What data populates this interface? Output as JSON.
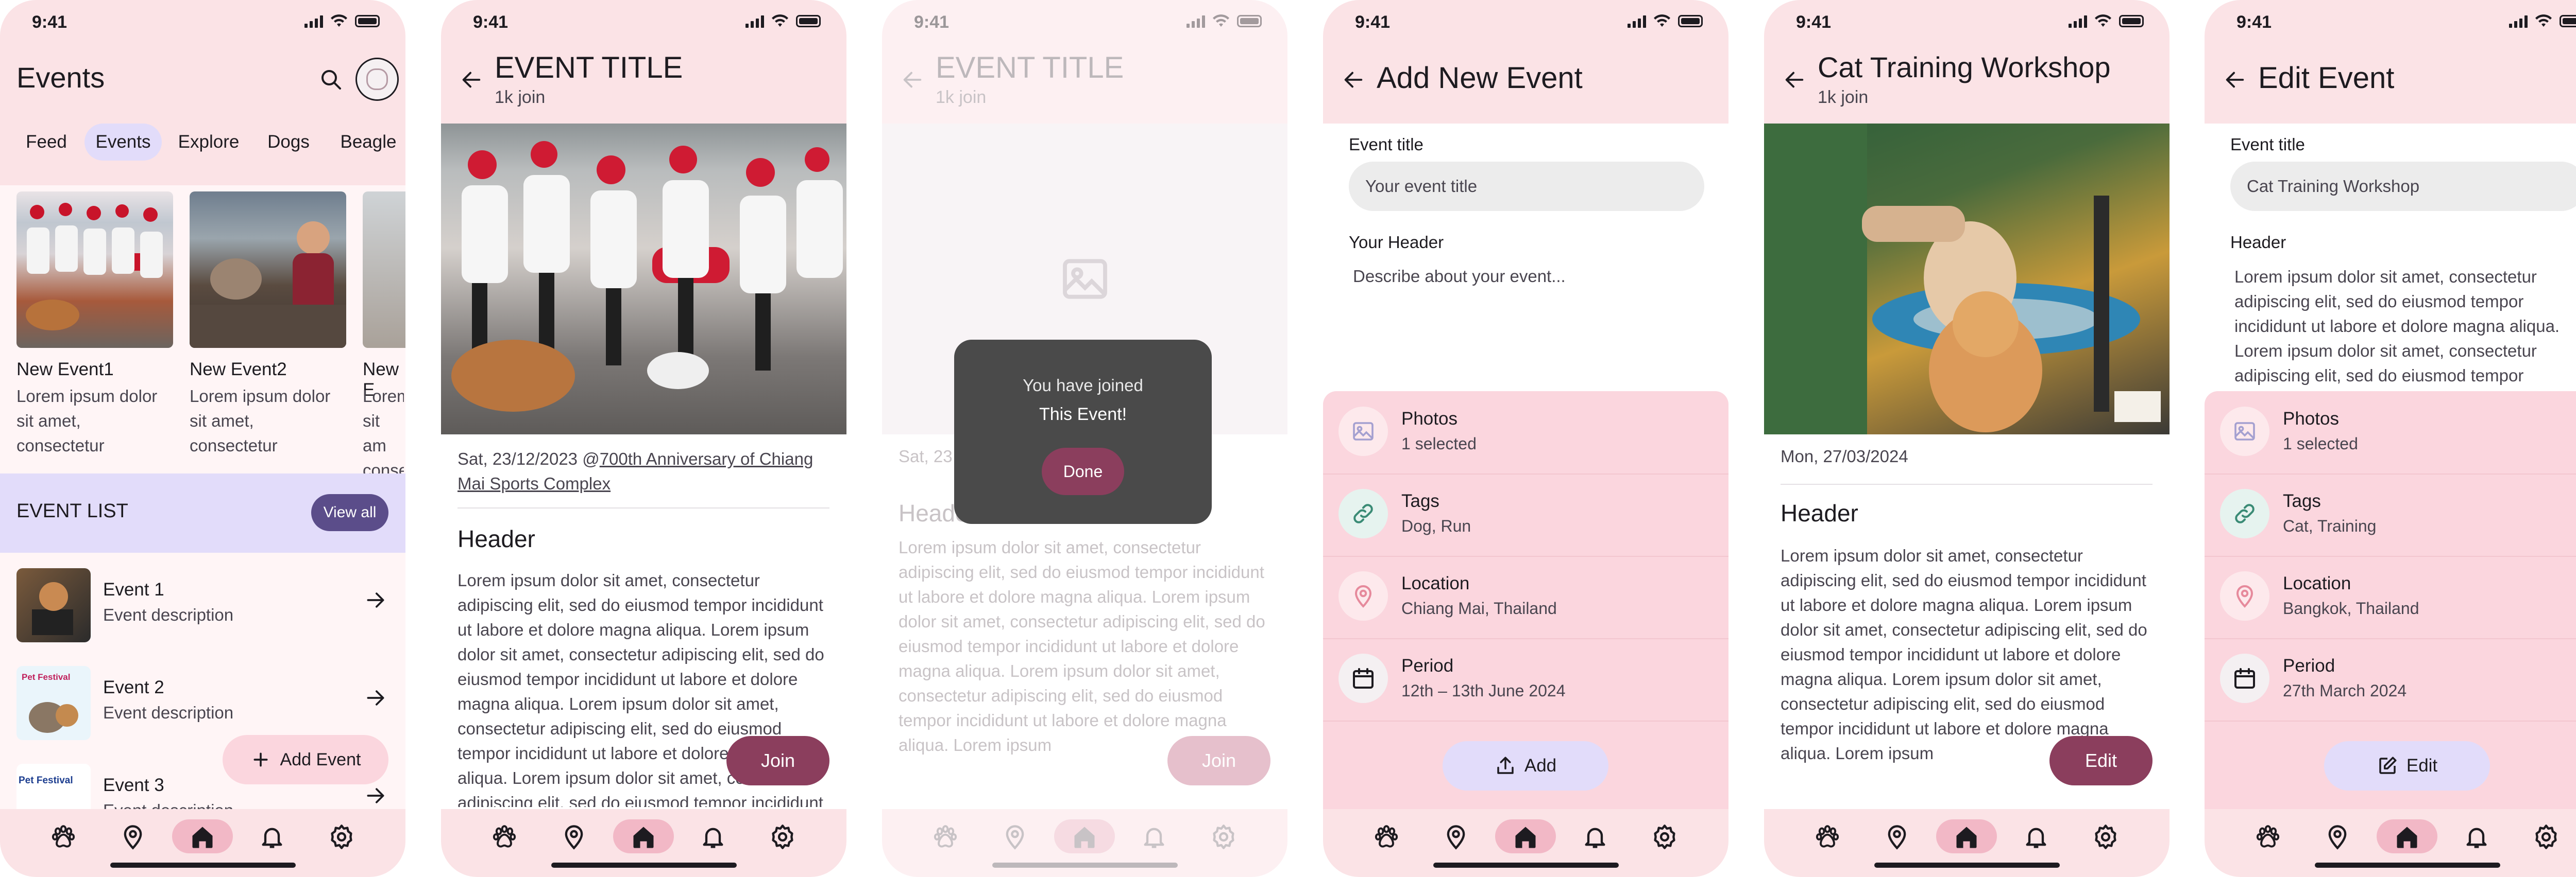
{
  "status": {
    "time": "9:41"
  },
  "colors": {
    "pink_bg": "#fbe3e6",
    "accent": "#8b3e5d",
    "lavender": "#e2dcfa",
    "meta_bg": "#fbd6de"
  },
  "screen1": {
    "title": "Events",
    "tabs": [
      "Feed",
      "Events",
      "Explore",
      "Dogs",
      "Beagle"
    ],
    "cards": [
      {
        "title": "New Event1",
        "desc": "Lorem ipsum dolor sit amet, consectetur"
      },
      {
        "title": "New Event2",
        "desc": "Lorem ipsum dolor sit amet, consectetur"
      },
      {
        "title": "New E",
        "desc": "Lorem sit am conse"
      }
    ],
    "event_list_title": "EVENT LIST",
    "view_all": "View all",
    "list": [
      {
        "title": "Event 1",
        "desc": "Event description"
      },
      {
        "title": "Event 2",
        "desc": "Event description"
      },
      {
        "title": "Event 3",
        "desc": "Event description"
      }
    ],
    "thumb2_badge": "Pet Festival",
    "thumb3_badge": "Pet Festival",
    "add_event": "Add Event"
  },
  "screen2": {
    "title": "EVENT TITLE",
    "join_count": "1k join",
    "date_line_prefix": "Sat, 23/12/2023 @",
    "date_line_link": "700th Anniversary of Chiang Mai Sports Complex",
    "header": "Header",
    "body": "Lorem ipsum dolor sit amet, consectetur adipiscing elit, sed do eiusmod tempor incididunt ut labore et dolore magna aliqua. Lorem ipsum dolor sit amet, consectetur adipiscing elit, sed do eiusmod tempor incididunt ut labore et dolore magna aliqua. Lorem ipsum dolor sit amet, consectetur adipiscing elit, sed do eiusmod tempor incididunt ut labore et dolore magna aliqua. Lorem ipsum dolor sit amet, consectetur adipiscing elit, sed do eiusmod tempor incididunt ut labore et dolore magna aliqua. Lorem ipsum",
    "join": "Join"
  },
  "screen3": {
    "title": "EVENT TITLE",
    "join_count": "1k join",
    "date_line": "Sat, 23",
    "header": "Heade",
    "body": "Lorem ipsum dolor sit amet, consectetur adipiscing elit, sed do eiusmod tempor incididunt ut labore et dolore magna aliqua. Lorem ipsum dolor sit amet, consectetur adipiscing elit, sed do eiusmod tempor incididunt ut labore et dolore magna aliqua. Lorem ipsum dolor sit amet, consectetur adipiscing elit, sed do eiusmod tempor incididunt ut labore et dolore magna aliqua. Lorem ipsum",
    "dialog_line1": "You have joined",
    "dialog_line2": "This Event!",
    "done": "Done",
    "join": "Join"
  },
  "screen4": {
    "title": "Add New Event",
    "event_title_label": "Event title",
    "event_title_placeholder": "Your event title",
    "header_label": "Your Header",
    "header_placeholder": "Describe about your event...",
    "meta": [
      {
        "title": "Photos",
        "value": "1 selected"
      },
      {
        "title": "Tags",
        "value": "Dog, Run"
      },
      {
        "title": "Location",
        "value": "Chiang Mai, Thailand"
      },
      {
        "title": "Period",
        "value": "12th – 13th June 2024"
      }
    ],
    "add": "Add"
  },
  "screen5": {
    "title": "Cat Training Workshop",
    "join_count": "1k join",
    "date_line": "Mon, 27/03/2024",
    "header": "Header",
    "body": "Lorem ipsum dolor sit amet, consectetur adipiscing elit, sed do eiusmod tempor incididunt ut labore et dolore magna aliqua. Lorem ipsum dolor sit amet, consectetur adipiscing elit, sed do eiusmod tempor incididunt ut labore et dolore magna aliqua. Lorem ipsum dolor sit amet, consectetur adipiscing elit, sed do eiusmod tempor incididunt ut labore et dolore magna aliqua. Lorem ipsum",
    "edit": "Edit"
  },
  "screen6": {
    "title": "Edit Event",
    "event_title_label": "Event title",
    "event_title_value": "Cat Training Workshop",
    "header_label": "Header",
    "header_value": "Lorem ipsum dolor sit amet, consectetur adipiscing elit, sed do eiusmod tempor incididunt ut labore et dolore magna aliqua. Lorem ipsum dolor sit amet, consectetur adipiscing elit, sed do eiusmod tempor",
    "meta": [
      {
        "title": "Photos",
        "value": "1 selected"
      },
      {
        "title": "Tags",
        "value": "Cat, Training"
      },
      {
        "title": "Location",
        "value": "Bangkok, Thailand"
      },
      {
        "title": "Period",
        "value": "27th March 2024"
      }
    ],
    "edit": "Edit"
  },
  "nav_icons": [
    "paw-icon",
    "location-icon",
    "home-icon",
    "bell-icon",
    "settings-icon"
  ]
}
